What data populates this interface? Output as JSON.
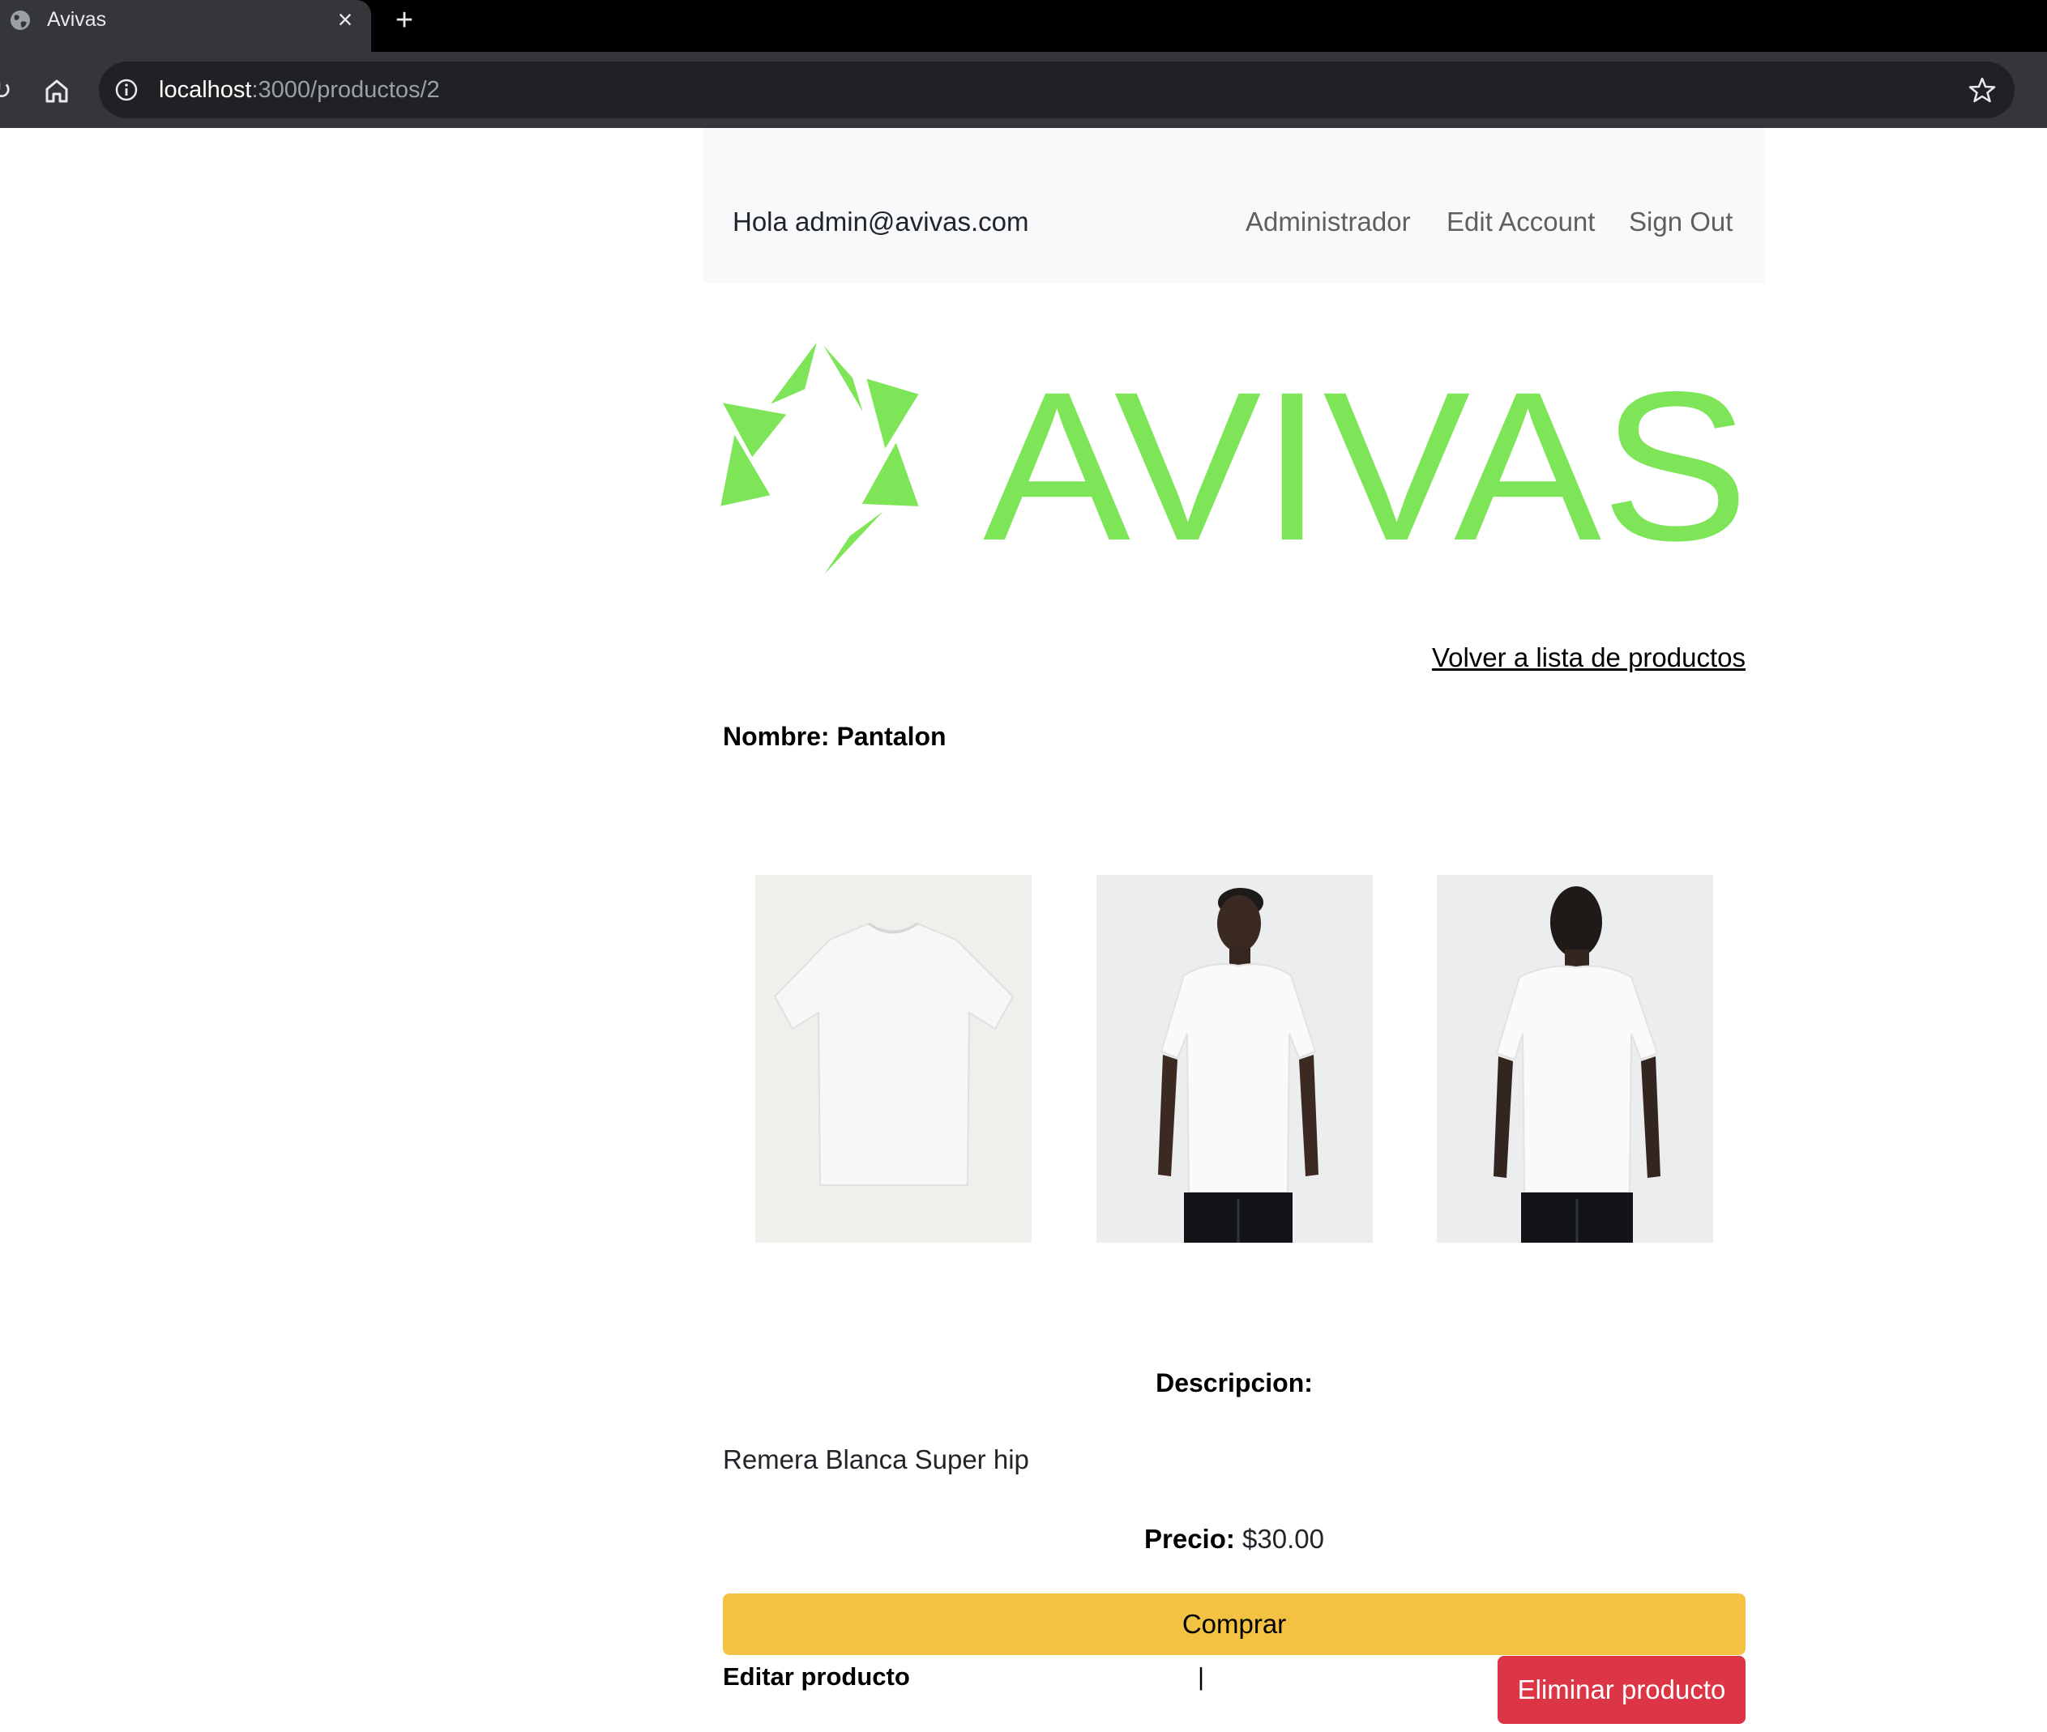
{
  "browser": {
    "tab_title": "Avivas",
    "tab_close_glyph": "×",
    "new_tab_glyph": "+",
    "url_host": "localhost",
    "url_path": ":3000/productos/2",
    "icons": [
      "globe-icon",
      "close-icon",
      "plus-icon",
      "reload-icon",
      "home-icon",
      "info-icon",
      "star-icon"
    ]
  },
  "navbar": {
    "greeting": "Hola admin@avivas.com",
    "links": [
      "Administrador",
      "Edit Account",
      "Sign Out"
    ]
  },
  "logo": {
    "text": "AVIVAS",
    "color": "#7ee559"
  },
  "product": {
    "back_link": "Volver a lista de productos",
    "name_line": "Nombre: Pantalon",
    "images": [
      {
        "alt": "white t-shirt flat lay"
      },
      {
        "alt": "model wearing white t-shirt, front view"
      },
      {
        "alt": "model wearing white t-shirt, back view"
      }
    ],
    "description_label": "Descripcion:",
    "description": "Remera Blanca Super hip",
    "price_label": "Precio:",
    "price_value": "$30.00"
  },
  "actions": {
    "buy_label": "Comprar",
    "edit_label": "Editar producto",
    "separator": "|",
    "delete_label": "Eliminar producto"
  },
  "colors": {
    "buy_button": "#f4c243",
    "delete_button": "#dc3545",
    "navbar_bg": "#f8f9fa"
  }
}
